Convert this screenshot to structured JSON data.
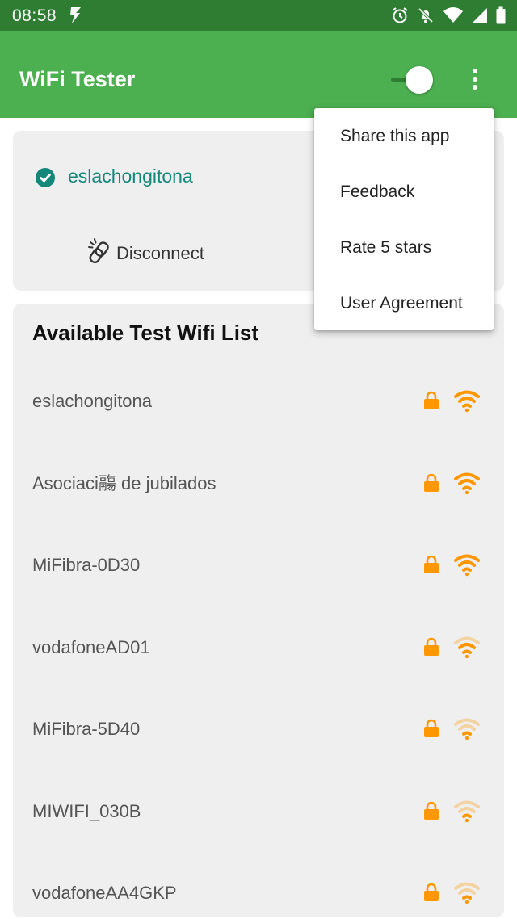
{
  "status_bar": {
    "time": "08:58",
    "icons": [
      "bolt-icon",
      "alarm-icon",
      "notifications-off-icon",
      "wifi-icon",
      "cell-signal-icon",
      "battery-icon"
    ]
  },
  "app_bar": {
    "title": "WiFi Tester",
    "toggle_on": true,
    "background_color": "#4caf50",
    "status_color": "#2e7d32"
  },
  "connected": {
    "ssid": "eslachongitona",
    "disconnect_label": "Disconnect",
    "ssid_color": "#13877a"
  },
  "wifi_list": {
    "title": "Available Test Wifi List",
    "items": [
      {
        "name": "eslachongitona",
        "locked": true,
        "signal": 1.0
      },
      {
        "name": "Asociaci鬺 de jubilados",
        "locked": true,
        "signal": 1.0
      },
      {
        "name": "MiFibra-0D30",
        "locked": true,
        "signal": 1.0
      },
      {
        "name": "vodafoneAD01",
        "locked": true,
        "signal": 0.75
      },
      {
        "name": "MiFibra-5D40",
        "locked": true,
        "signal": 0.5
      },
      {
        "name": "MIWIFI_030B",
        "locked": true,
        "signal": 0.5
      },
      {
        "name": "vodafoneAA4GKP",
        "locked": true,
        "signal": 0.5
      }
    ],
    "accent_color": "#ff9800"
  },
  "overflow_menu": {
    "items": [
      "Share this app",
      "Feedback",
      "Rate 5 stars",
      "User Agreement"
    ]
  }
}
